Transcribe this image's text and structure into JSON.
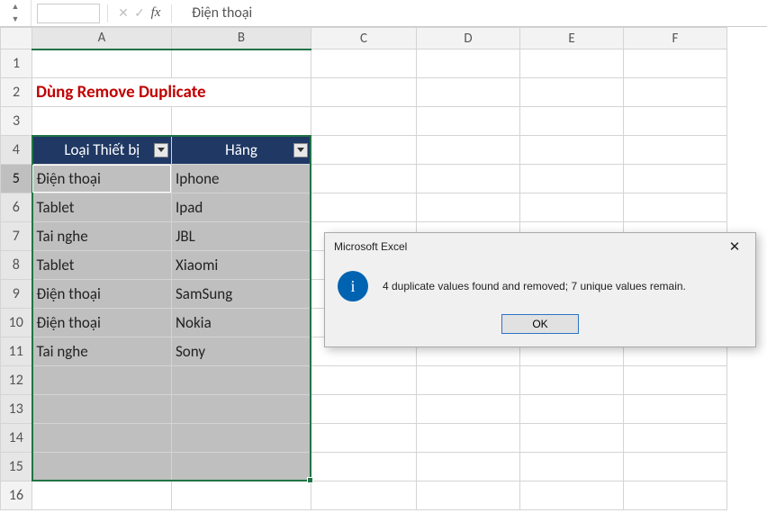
{
  "formula_bar": {
    "name_box": "",
    "content": "Điện thoại"
  },
  "columns": [
    "A",
    "B",
    "C",
    "D",
    "E",
    "F"
  ],
  "col_sel": [
    "A",
    "B"
  ],
  "rows_total": 16,
  "row_sel_active": 5,
  "row_sel_range": [
    4,
    15
  ],
  "title_cell": {
    "row": 2,
    "col": "A",
    "text": "Dùng Remove Duplicate"
  },
  "table": {
    "header_row": 4,
    "headers": [
      "Loại Thiết bị",
      "Hãng"
    ],
    "rows": [
      [
        "Điện thoại",
        "Iphone"
      ],
      [
        "Tablet",
        "Ipad"
      ],
      [
        "Tai nghe",
        "JBL"
      ],
      [
        "Tablet",
        "Xiaomi"
      ],
      [
        "Điện thoại",
        "SamSung"
      ],
      [
        "Điện thoại",
        "Nokia"
      ],
      [
        "Tai nghe",
        "Sony"
      ]
    ],
    "selection_extends_to_row": 15
  },
  "dialog": {
    "title": "Microsoft Excel",
    "message": "4 duplicate values found and removed; 7 unique values remain.",
    "ok": "OK"
  }
}
